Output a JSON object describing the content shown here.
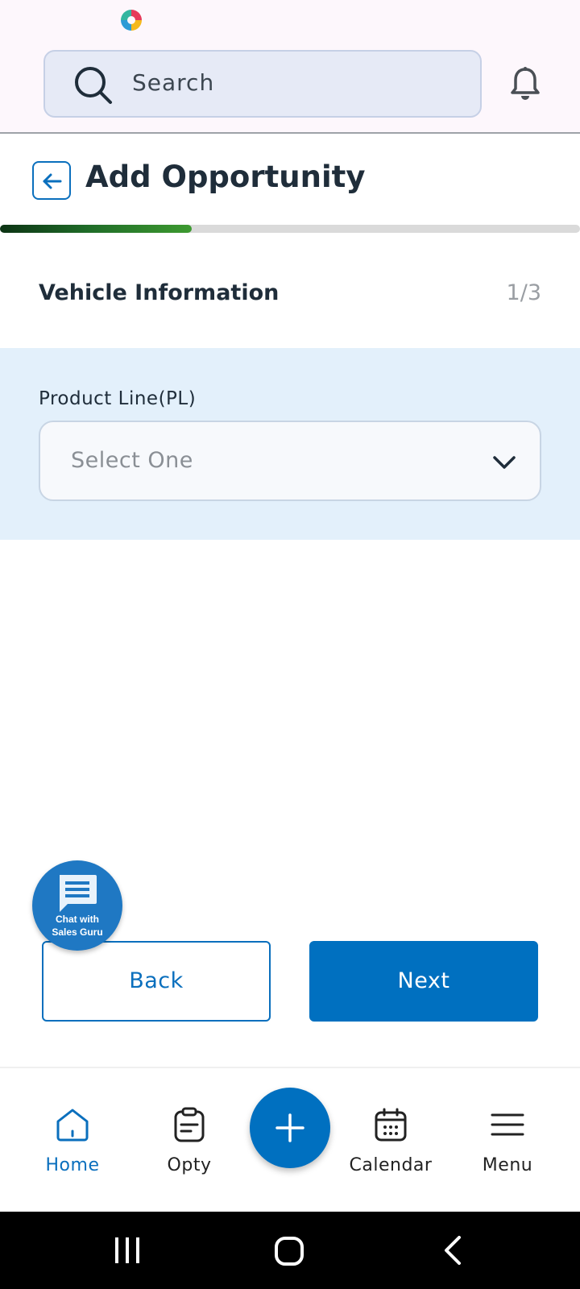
{
  "header": {
    "search_placeholder": "Search",
    "icons": {
      "search": "search-icon",
      "notifications": "bell-icon"
    }
  },
  "page": {
    "title": "Add Opportunity",
    "progress_fraction": 0.33
  },
  "section": {
    "title": "Vehicle Information",
    "step": "1/3"
  },
  "form": {
    "product_line_label": "Product Line(PL)",
    "product_line_placeholder": "Select One"
  },
  "chat": {
    "line1": "Chat with",
    "line2": "Sales Guru"
  },
  "actions": {
    "back_label": "Back",
    "next_label": "Next"
  },
  "bottom_nav": {
    "items": [
      {
        "label": "Home",
        "icon": "home-icon",
        "active": true
      },
      {
        "label": "Opty",
        "icon": "clipboard-icon",
        "active": false
      },
      {
        "label": "Calendar",
        "icon": "calendar-icon",
        "active": false
      },
      {
        "label": "Menu",
        "icon": "hamburger-menu-icon",
        "active": false
      }
    ],
    "add_icon": "plus-icon"
  },
  "colors": {
    "primary": "#0070c0",
    "panel": "#e3f0fb",
    "progress_dark": "#0c3314",
    "progress_light": "#3d9a30"
  }
}
